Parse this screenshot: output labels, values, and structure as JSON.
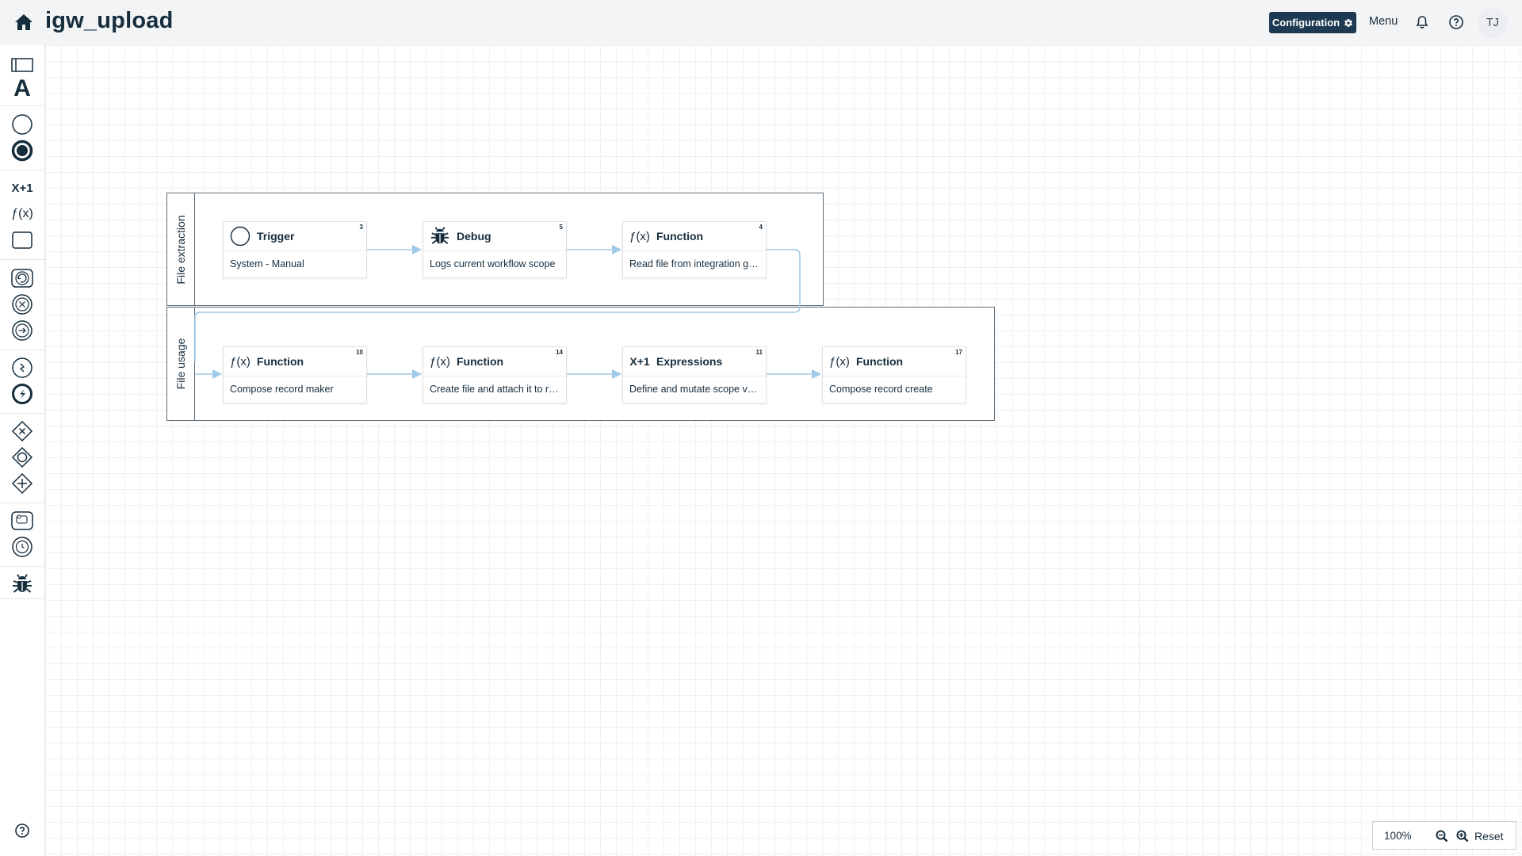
{
  "header": {
    "title": "igw_upload",
    "configuration_label": "Configuration",
    "menu_label": "Menu",
    "avatar_initials": "TJ",
    "accent_color": "#1e3a52"
  },
  "toolbar": {
    "tools": [
      "swimlane-icon",
      "text-annotation-icon",
      "start-event-icon",
      "end-event-icon",
      "expression-icon",
      "function-icon",
      "task-icon",
      "loop-icon",
      "break-icon",
      "continue-icon",
      "event-catch-icon",
      "event-throw-icon",
      "exclusive-gateway-icon",
      "inclusive-gateway-icon",
      "parallel-gateway-icon",
      "delay-icon",
      "timer-icon",
      "debug-icon"
    ],
    "expression_text": "X+1",
    "function_text": "ƒ(x)"
  },
  "lanes": [
    {
      "label": "File extraction"
    },
    {
      "label": "File usage"
    }
  ],
  "nodes": [
    {
      "id": "3",
      "title": "Trigger",
      "description": "System - Manual",
      "icon": "start-event-icon"
    },
    {
      "id": "5",
      "title": "Debug",
      "description": "Logs current workflow scope",
      "icon": "debug-icon"
    },
    {
      "id": "4",
      "title": "Function",
      "description": "Read file from integration gateway",
      "icon": "function-icon"
    },
    {
      "id": "10",
      "title": "Function",
      "description": "Compose record maker",
      "icon": "function-icon"
    },
    {
      "id": "14",
      "title": "Function",
      "description": "Create file and attach it to record",
      "icon": "function-icon"
    },
    {
      "id": "11",
      "title": "Expressions",
      "description": "Define and mutate scope variables",
      "icon": "expression-icon"
    },
    {
      "id": "17",
      "title": "Function",
      "description": "Compose record create",
      "icon": "function-icon"
    }
  ],
  "zoom": {
    "value": "100%",
    "reset_label": "Reset"
  },
  "edge_color": "#9fc9e6"
}
